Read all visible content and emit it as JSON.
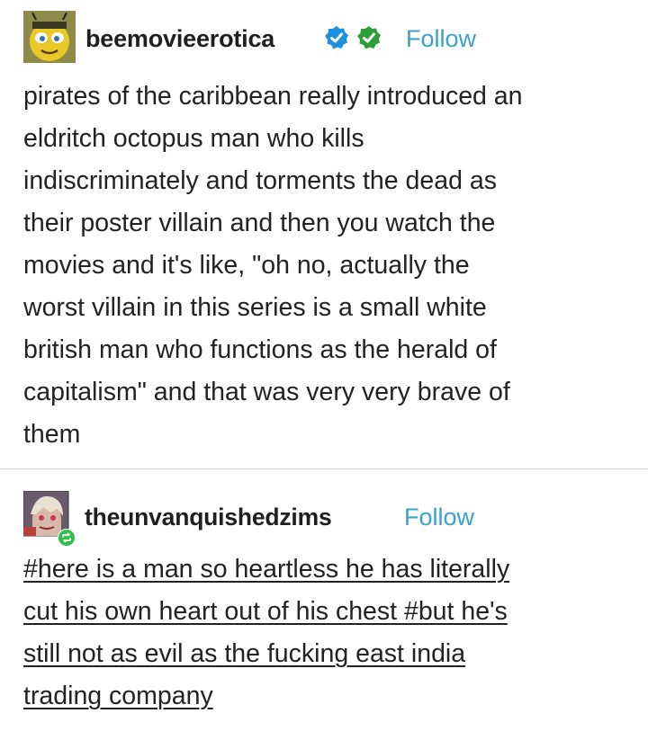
{
  "posts": [
    {
      "username": "beemovieerotica",
      "follow_label": "Follow",
      "avatar_icon": "bee-avatar-icon",
      "badges": [
        "blue-verified-badge-icon",
        "green-verified-badge-icon"
      ],
      "lines": [
        "pirates of the caribbean really introduced an",
        "eldritch octopus man who kills",
        "indiscriminately and torments the dead as",
        "their poster villain and then you watch the",
        "movies and it's like, \"oh no, actually the",
        "worst villain in this series is a small white",
        "british man who functions as the herald of",
        "capitalism\" and that was very very brave of",
        "them"
      ]
    },
    {
      "username": "theunvanquishedzims",
      "follow_label": "Follow",
      "avatar_icon": "anime-avatar-icon",
      "reblog_badge_icon": "reblog-icon",
      "tag_lines": [
        "#here is a man so heartless he has literally",
        "cut his own heart out of his chest #but he's",
        "still not as evil as the fucking east india",
        "trading company"
      ]
    }
  ],
  "colors": {
    "follow": "#3aa0cc",
    "text": "#222222",
    "verified_blue": "#1d8fe1",
    "verified_green": "#2e9e3a"
  }
}
